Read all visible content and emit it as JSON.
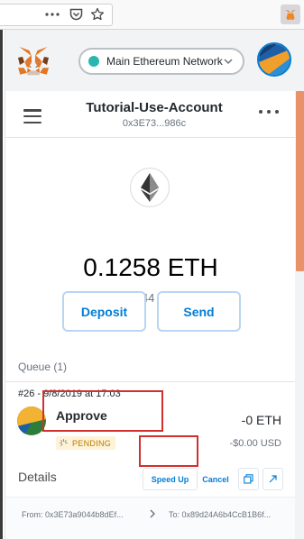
{
  "browser": {
    "icons": [
      "more-horizontal-icon",
      "pocket-icon",
      "bookmark-star-icon",
      "metamask-extension-icon"
    ]
  },
  "header": {
    "network_name": "Main Ethereum Network",
    "network_color": "#29b6af"
  },
  "account": {
    "name": "Tutorial-Use-Account",
    "address": "0x3E73...986c"
  },
  "balance": {
    "primary": "0.1258 ETH",
    "secondary": "$21.44 USD"
  },
  "actions": {
    "deposit": "Deposit",
    "send": "Send"
  },
  "queue": {
    "label": "Queue (1)",
    "transaction": {
      "meta": "#26 - 9/8/2019 at 17:03",
      "title": "Approve",
      "status": "PENDING",
      "value": "-0 ETH",
      "fiat": "-$0.00 USD",
      "details_label": "Details",
      "speed_up": "Speed Up",
      "cancel": "Cancel",
      "from": "From: 0x3E73a9044b8dEf...",
      "to": "To: 0x89d24A6b4CcB1B6f..."
    }
  },
  "colors": {
    "accent": "#037dd6",
    "pending_bg": "#fef3d7",
    "pending_text": "#b87b00",
    "annotation": "#d0312d",
    "scroll_thumb": "#e9916a"
  }
}
